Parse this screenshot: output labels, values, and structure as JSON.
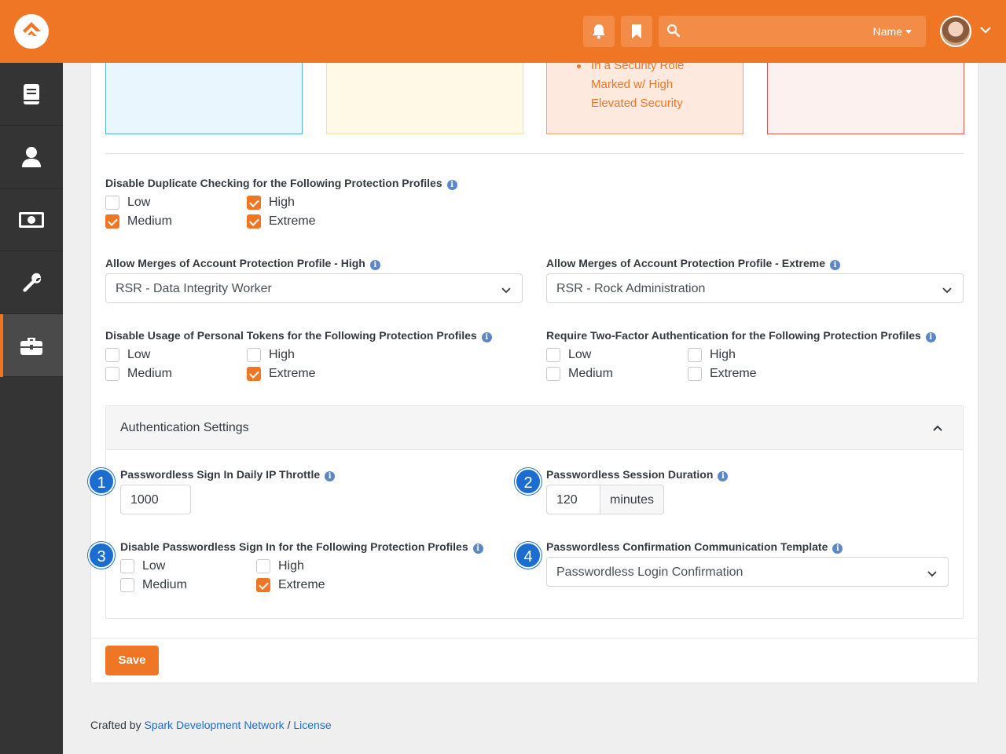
{
  "topbar": {
    "search_placeholder": "",
    "search_scope": "Name",
    "notifications_icon": "bell-icon",
    "bookmarks_icon": "bookmark-icon"
  },
  "sidebar": {
    "items": [
      {
        "icon": "book-icon"
      },
      {
        "icon": "person-icon"
      },
      {
        "icon": "money-icon"
      },
      {
        "icon": "wrench-icon"
      },
      {
        "icon": "briefcase-icon",
        "active": true
      }
    ]
  },
  "cards": {
    "elevated_list": [
      "In a Security Role",
      "Marked w/ High",
      "Elevated Security"
    ]
  },
  "duplicate_checking": {
    "label": "Disable Duplicate Checking for the Following Protection Profiles",
    "options": [
      {
        "label": "Low",
        "checked": false
      },
      {
        "label": "Medium",
        "checked": true
      },
      {
        "label": "High",
        "checked": true
      },
      {
        "label": "Extreme",
        "checked": true
      }
    ]
  },
  "merge_high": {
    "label": "Allow Merges of Account Protection Profile - High",
    "value": "RSR - Data Integrity Worker"
  },
  "merge_extreme": {
    "label": "Allow Merges of Account Protection Profile - Extreme",
    "value": "RSR - Rock Administration"
  },
  "personal_tokens": {
    "label": "Disable Usage of Personal Tokens for the Following Protection Profiles",
    "options": [
      {
        "label": "Low",
        "checked": false
      },
      {
        "label": "Medium",
        "checked": false
      },
      {
        "label": "High",
        "checked": false
      },
      {
        "label": "Extreme",
        "checked": true
      }
    ]
  },
  "two_factor": {
    "label": "Require Two-Factor Authentication for the Following Protection Profiles",
    "options": [
      {
        "label": "Low",
        "checked": false
      },
      {
        "label": "Medium",
        "checked": false
      },
      {
        "label": "High",
        "checked": false
      },
      {
        "label": "Extreme",
        "checked": false
      }
    ]
  },
  "auth_settings": {
    "title": "Authentication Settings",
    "ip_throttle": {
      "number": "1",
      "label": "Passwordless Sign In Daily IP Throttle",
      "value": "1000"
    },
    "session_duration": {
      "number": "2",
      "label": "Passwordless Session Duration",
      "value": "120",
      "unit": "minutes"
    },
    "disable_passwordless": {
      "number": "3",
      "label": "Disable Passwordless Sign In for the Following Protection Profiles",
      "options": [
        {
          "label": "Low",
          "checked": false
        },
        {
          "label": "Medium",
          "checked": false
        },
        {
          "label": "High",
          "checked": false
        },
        {
          "label": "Extreme",
          "checked": true
        }
      ]
    },
    "confirmation_template": {
      "number": "4",
      "label": "Passwordless Confirmation Communication Template",
      "value": "Passwordless Login Confirmation"
    }
  },
  "save_label": "Save",
  "footer": {
    "prefix": "Crafted by",
    "link1": "Spark Development Network",
    "sep": "/",
    "link2": "License"
  },
  "colors": {
    "brand": "#ee7625",
    "sidebar": "#343434",
    "step_badge": "#1b6ed0"
  }
}
